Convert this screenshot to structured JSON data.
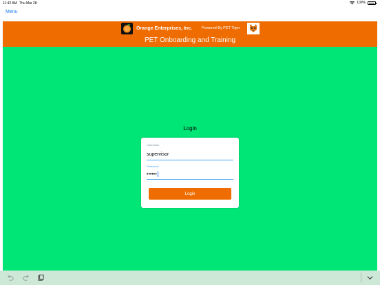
{
  "status_bar": {
    "time": "11:42 AM",
    "date": "Thu Mar 28",
    "battery": "100%",
    "icons": [
      "wifi-icon",
      "battery-icon"
    ]
  },
  "nav": {
    "menu_label": "Menu"
  },
  "header": {
    "company_name": "Orange Enterprises, Inc.",
    "powered_by": "Powered By PET Tiger",
    "title": "PET Onboarding and Training",
    "logos": [
      "orange-logo",
      "tiger-logo"
    ]
  },
  "login": {
    "heading": "Login",
    "username_label": "Username",
    "username_value": "supervisor",
    "password_label": "Password",
    "password_value": "••••••",
    "button_label": "Login"
  },
  "keyboard_toolbar": {
    "icons": [
      "undo-icon",
      "redo-icon",
      "paste-icon",
      "dismiss-keyboard-icon"
    ]
  },
  "colors": {
    "header_orange": "#ef6c00",
    "background_green": "#00e676",
    "link_blue": "#1b7cf4",
    "field_focus_blue": "#42a5f5",
    "toolbar_bg": "#cde8d6"
  }
}
